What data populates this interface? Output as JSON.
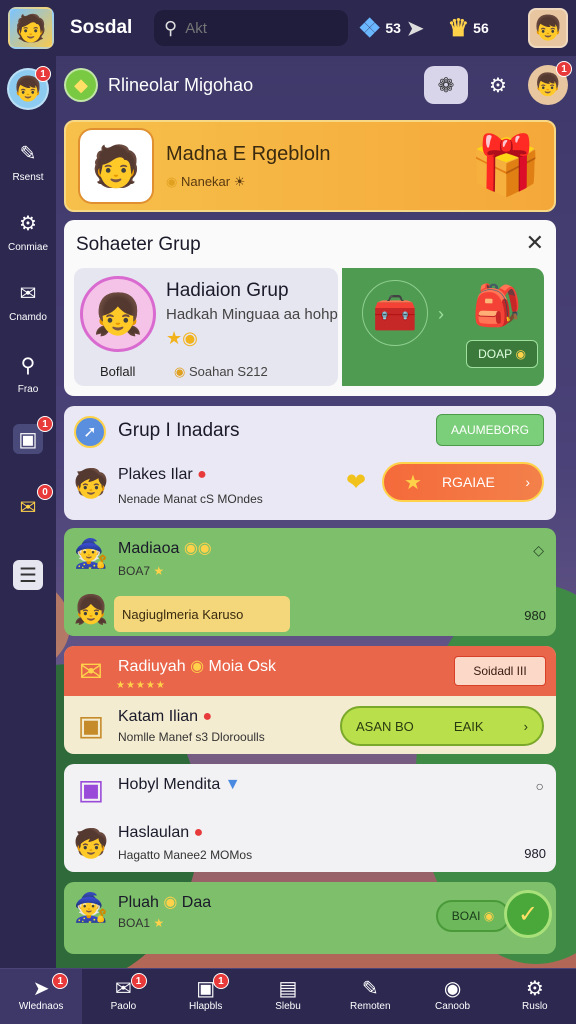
{
  "app": {
    "title": "Sosdal",
    "search_placeholder": "Akt",
    "currency1": "53",
    "currency2": "56"
  },
  "sidebar": {
    "avatar_badge": "1",
    "items": [
      {
        "label": "Rsenst",
        "icon": "pencil-icon",
        "badge": ""
      },
      {
        "label": "Conmiae",
        "icon": "gear-icon",
        "badge": ""
      },
      {
        "label": "Cnamdo",
        "icon": "chat-icon",
        "badge": ""
      },
      {
        "label": "Frao",
        "icon": "pin-icon",
        "badge": ""
      },
      {
        "label": "",
        "icon": "chat-bubble-icon",
        "badge": "1"
      },
      {
        "label": "",
        "icon": "megaphone-icon",
        "badge": "0"
      },
      {
        "label": "",
        "icon": "menu-icon",
        "badge": ""
      }
    ]
  },
  "header": {
    "title": "Rlineolar Migohao",
    "avatar_badge": "1"
  },
  "banner": {
    "title": "Madna E Rgebloln",
    "subtitle": "Nanekar"
  },
  "popup": {
    "title": "Sohaeter Grup",
    "group_name": "Hadiaion Grup",
    "group_sub": "Hadkah Minguaa aa hohp",
    "bottom_label": "Boflall",
    "coin_label": "Soahan S212",
    "go_label": "DOAP"
  },
  "group_list": {
    "title": "Grup I Inadars",
    "button": "AAUMEBORG",
    "row_name": "Plakes Ilar",
    "row_sub": "Nenade Manat cS MOndes",
    "action_label": "RGAIAE"
  },
  "green_group": {
    "name": "Madiaoa",
    "sub": "BOA7",
    "message": "Nagiuglmeria Karuso",
    "count": "980"
  },
  "red_group": {
    "name": "Radiuyah",
    "name2": "Moia Osk",
    "button": "Soidadl III",
    "row_name": "Katam Ilian",
    "row_sub": "Nomlle Manef s3 Dlorooulls",
    "lime_left": "ASAN BO",
    "lime_right": "EAIK"
  },
  "white_group": {
    "name": "Hobyl Mendita",
    "row_name": "Haslaulan",
    "row_sub": "Hagatto Manee2 MOMos",
    "count": "980"
  },
  "green_group2": {
    "name": "Pluah",
    "name2": "Daa",
    "sub": "BOA1",
    "button": "BOAI"
  },
  "bottom_nav": [
    {
      "label": "Wlednaos",
      "icon": "rocket-icon",
      "badge": "1"
    },
    {
      "label": "Paolo",
      "icon": "chat-icon",
      "badge": "1"
    },
    {
      "label": "Hlapbls",
      "icon": "camera-icon",
      "badge": "1"
    },
    {
      "label": "Slebu",
      "icon": "bag-icon",
      "badge": ""
    },
    {
      "label": "Remoten",
      "icon": "pen-icon",
      "badge": ""
    },
    {
      "label": "Canoob",
      "icon": "compass-icon",
      "badge": ""
    },
    {
      "label": "Ruslo",
      "icon": "gear-icon",
      "badge": ""
    }
  ],
  "colors": {
    "panel": "#2c2850",
    "banner": "#f6c04a",
    "green": "#7dbf6a",
    "red": "#e9664a",
    "badge": "#e83a3a"
  }
}
